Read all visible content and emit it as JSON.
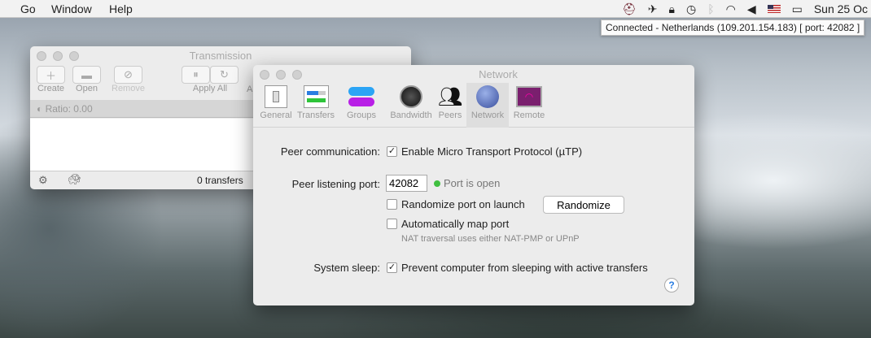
{
  "menubar": {
    "items": [
      "Go",
      "Window",
      "Help"
    ],
    "clock": "Sun 25 Oc",
    "status_icons": [
      "vpn-icon",
      "crane-icon",
      "lock-icon",
      "time-machine-icon",
      "bluetooth-icon",
      "wifi-icon",
      "volume-icon",
      "us-flag-icon",
      "battery-icon"
    ]
  },
  "tooltip": "Connected - Netherlands (109.201.154.183) [ port: 42082 ]",
  "main_window": {
    "title": "Transmission",
    "toolbar": [
      "Create",
      "Open",
      "Remove",
      "Apply All",
      "A"
    ],
    "ratio": "Ratio: 0.00",
    "footer": "0 transfers"
  },
  "prefs": {
    "title": "Network",
    "tabs": [
      "General",
      "Transfers",
      "Groups",
      "Bandwidth",
      "Peers",
      "Network",
      "Remote"
    ],
    "selected_tab": "Network",
    "peer_comm_label": "Peer communication:",
    "utp": "Enable Micro Transport Protocol (µTP)",
    "utp_checked": true,
    "port_label": "Peer listening port:",
    "port_value": "42082",
    "port_status": "Port is open",
    "port_status_color": "#3fbf3f",
    "randomize_launch": "Randomize port on launch",
    "randomize_button": "Randomize",
    "auto_map": "Automatically map port",
    "nat_note": "NAT traversal uses either NAT-PMP or UPnP",
    "sleep_label": "System sleep:",
    "sleep": "Prevent computer from sleeping with active transfers",
    "sleep_checked": true,
    "help": "?"
  }
}
